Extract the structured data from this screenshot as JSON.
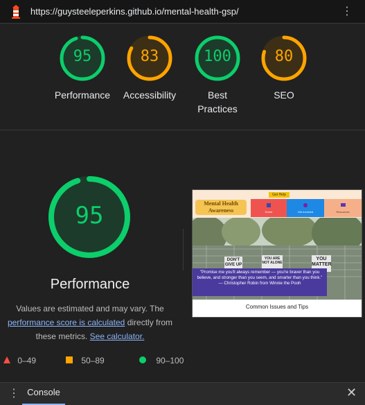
{
  "url_bar": {
    "url": "https://guysteeleperkins.github.io/mental-health-gsp/",
    "menu_icon": "kebab-menu-icon"
  },
  "scores": [
    {
      "label": "Performance",
      "value": "95",
      "fraction": 0.95,
      "color": "#0cce6b",
      "track": "#1d3b2a"
    },
    {
      "label": "Accessibility",
      "value": "83",
      "fraction": 0.83,
      "color": "#ffa400",
      "track": "#3d2f15"
    },
    {
      "label": "Best\nPractices",
      "value": "100",
      "fraction": 1.0,
      "color": "#0cce6b",
      "track": "#1d3b2a"
    },
    {
      "label": "SEO",
      "value": "80",
      "fraction": 0.8,
      "color": "#ffa400",
      "track": "#3d2f15"
    }
  ],
  "main": {
    "title": "Performance",
    "score": "95",
    "fraction": 0.95,
    "desc_part1": "Values are estimated and may vary. The ",
    "desc_link1": "performance score is calculated",
    "desc_part2": " directly from these metrics. ",
    "desc_link2": "See calculator."
  },
  "legend": {
    "fail": "0–49",
    "average": "50–89",
    "pass": "90–100"
  },
  "thumbnail": {
    "get_help": "Get Help",
    "site_title": "Mental Health Awareness",
    "nav_items": [
      "Home",
      "Get Involved",
      "Resources"
    ],
    "quote": "\"Promise me you'll always remember — you're braver than you believe, and stronger than you seem, and smarter than you think.\" — Christopher Robin from Winnie the Pooh",
    "sign1": "DON'T GIVE UP",
    "sign2": "YOU ARE NOT ALONE",
    "sign3": "YOU MATTER",
    "footer_heading": "Common Issues and Tips"
  },
  "console": {
    "tab": "Console",
    "close_icon": "close-icon"
  }
}
